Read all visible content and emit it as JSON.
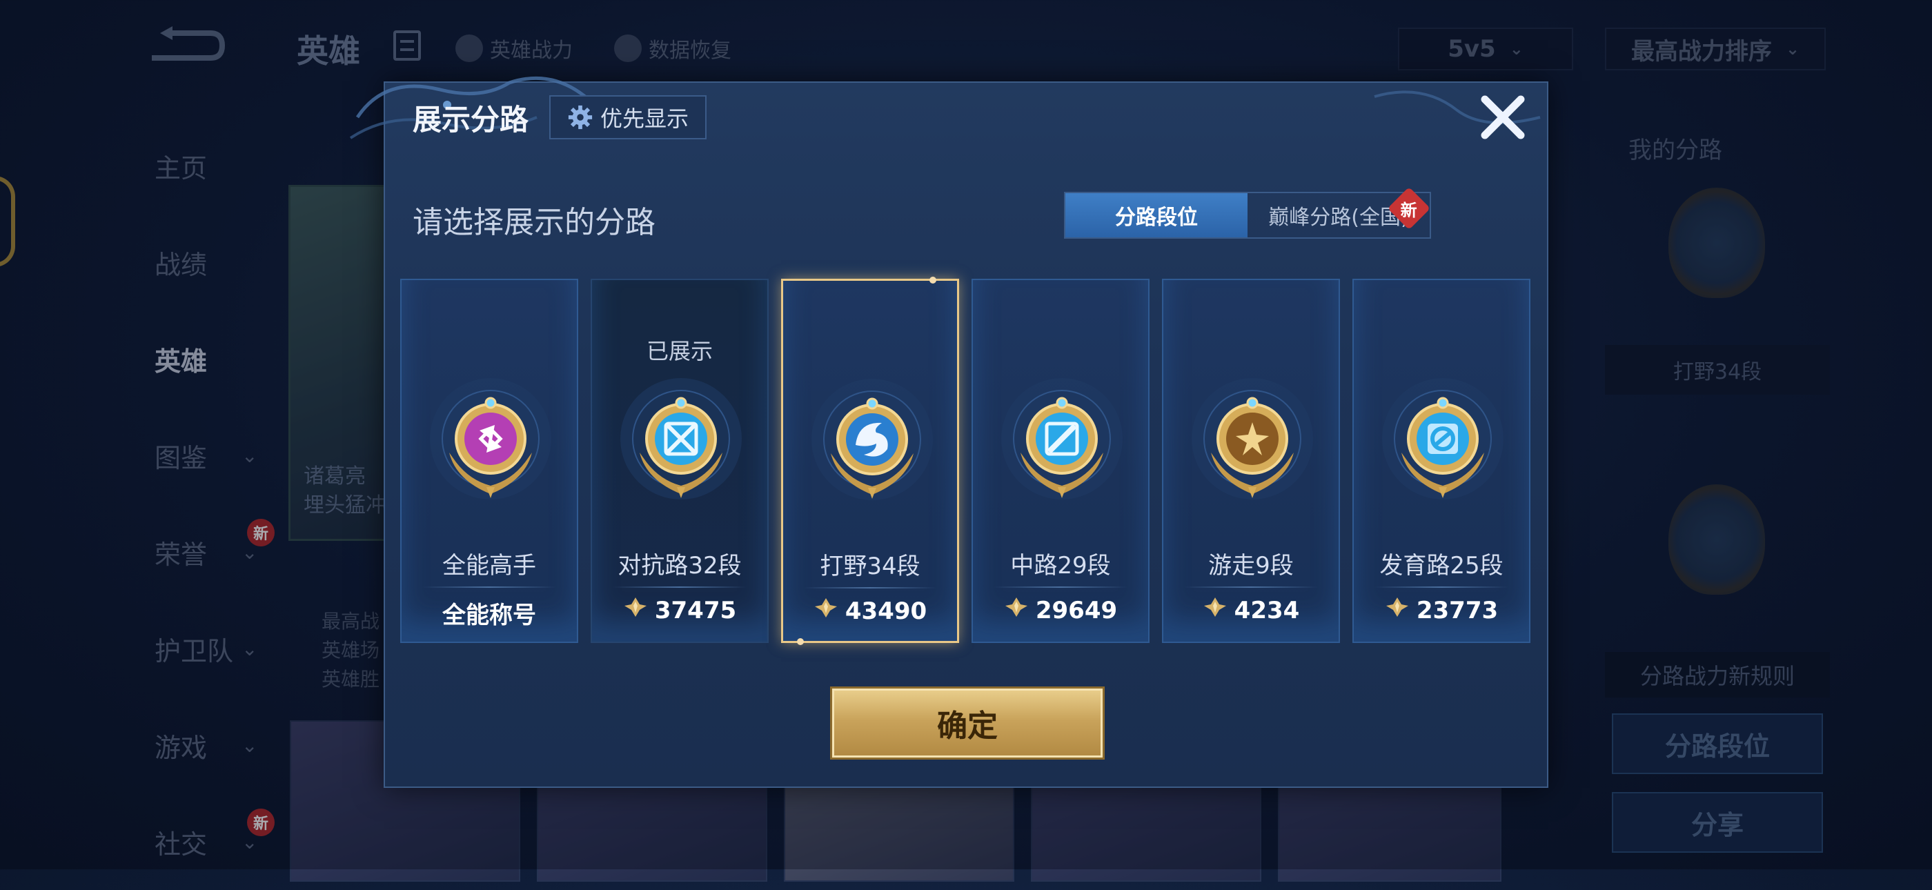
{
  "background": {
    "header": {
      "title": "英雄",
      "link_power": "英雄战力",
      "link_restore": "数据恢复",
      "mode_select": "5v5",
      "sort_select": "最高战力排序"
    },
    "side_menu": [
      {
        "label": "主页",
        "chevron": false,
        "new": false,
        "active": false
      },
      {
        "label": "战绩",
        "chevron": false,
        "new": false,
        "active": false
      },
      {
        "label": "英雄",
        "chevron": false,
        "new": false,
        "active": true
      },
      {
        "label": "图鉴",
        "chevron": true,
        "new": false,
        "active": false
      },
      {
        "label": "荣誉",
        "chevron": true,
        "new": true,
        "active": false
      },
      {
        "label": "护卫队",
        "chevron": true,
        "new": false,
        "active": false
      },
      {
        "label": "游戏",
        "chevron": true,
        "new": false,
        "active": false
      },
      {
        "label": "社交",
        "chevron": true,
        "new": true,
        "active": false
      }
    ],
    "new_tag": "新",
    "hero_card_text": [
      "诸葛亮",
      "埋头猛冲"
    ],
    "hero_stats": [
      "最高战",
      "英雄场",
      "英雄胜"
    ],
    "right_panel": {
      "title": "我的分路",
      "lane_label": "打野34段",
      "rule_text": "分路战力新规则",
      "btn_lane_rank": "分路段位",
      "btn_share": "分享"
    }
  },
  "modal": {
    "title": "展示分路",
    "priority_button": "优先显示",
    "subtitle": "请选择展示的分路",
    "tabs": [
      {
        "label": "分路段位",
        "active": true,
        "new": false
      },
      {
        "label": "巅峰分路(全国)",
        "active": false,
        "new": true
      }
    ],
    "new_tag": "新",
    "cards": [
      {
        "name": "全能高手",
        "power": "全能称号",
        "has_power_icon": false,
        "shown_tag": "",
        "emblem": "allround-emblem-icon",
        "core_color": "#b43fb4",
        "selected": false
      },
      {
        "name": "对抗路32段",
        "power": "37475",
        "has_power_icon": true,
        "shown_tag": "已展示",
        "emblem": "clash-lane-emblem-icon",
        "core_color": "#2aa8e8",
        "selected": false
      },
      {
        "name": "打野34段",
        "power": "43490",
        "has_power_icon": true,
        "shown_tag": "",
        "emblem": "jungle-emblem-icon",
        "core_color": "#2a7fd0",
        "selected": true
      },
      {
        "name": "中路29段",
        "power": "29649",
        "has_power_icon": true,
        "shown_tag": "",
        "emblem": "mid-lane-emblem-icon",
        "core_color": "#2aa8e8",
        "selected": false
      },
      {
        "name": "游走9段",
        "power": "4234",
        "has_power_icon": true,
        "shown_tag": "",
        "emblem": "roam-emblem-icon",
        "core_color": "#8a5a22",
        "selected": false
      },
      {
        "name": "发育路25段",
        "power": "23773",
        "has_power_icon": true,
        "shown_tag": "",
        "emblem": "farm-lane-emblem-icon",
        "core_color": "#2aa8e8",
        "selected": false
      }
    ],
    "confirm_button": "确定"
  },
  "colors": {
    "accent_gold": "#e8c888",
    "tab_active": "#3f7fc6",
    "modal_bg": "#1d3356",
    "new_badge": "#c83434"
  }
}
